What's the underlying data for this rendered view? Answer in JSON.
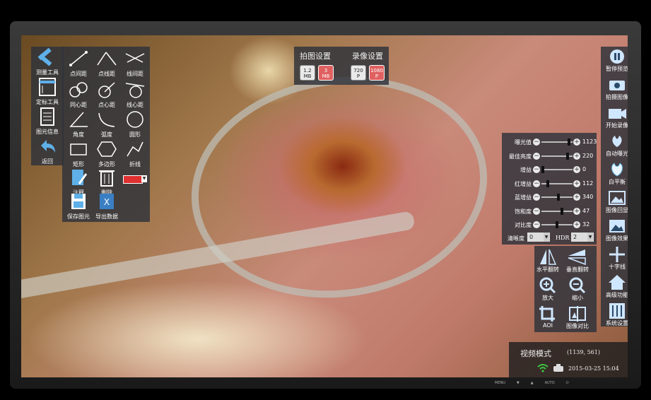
{
  "left_panel": {
    "main_tools": [
      {
        "label": "测量工具"
      },
      {
        "label": "定标工具"
      },
      {
        "label": "图元信息"
      },
      {
        "label": "返回"
      }
    ],
    "measure_tools": [
      {
        "label": "点间距"
      },
      {
        "label": "点线距"
      },
      {
        "label": "线间距"
      },
      {
        "label": "同心距"
      },
      {
        "label": "点心距"
      },
      {
        "label": "线心距"
      },
      {
        "label": "角度"
      },
      {
        "label": "弧度"
      },
      {
        "label": "圆形"
      },
      {
        "label": "矩形"
      },
      {
        "label": "多边形"
      },
      {
        "label": "折线"
      },
      {
        "label": "注释"
      },
      {
        "label": "删除"
      }
    ],
    "bottom_tools": [
      {
        "label": "保存图元"
      },
      {
        "label": "导出数据"
      }
    ],
    "color_swatch": "#e03030"
  },
  "top_panel": {
    "capture_title": "拍图设置",
    "record_title": "录像设置",
    "capture_options": [
      {
        "line1": "1.2",
        "line2": "MB"
      },
      {
        "line1": "3",
        "line2": "MB"
      }
    ],
    "record_options": [
      {
        "line1": "720",
        "line2": "P"
      },
      {
        "line1": "1080",
        "line2": "P"
      }
    ]
  },
  "right_tools": [
    {
      "label": "暂停预览"
    },
    {
      "label": "拍摄图像"
    },
    {
      "label": "开始录像"
    },
    {
      "label": "自动曝光"
    },
    {
      "label": "白平衡"
    },
    {
      "label": "图像回显"
    },
    {
      "label": "图像效果"
    },
    {
      "label": "十字线"
    },
    {
      "label": "高级功能"
    },
    {
      "label": "系统设置"
    }
  ],
  "sliders": [
    {
      "label": "曝光值",
      "value": "1123",
      "pos": 0.92
    },
    {
      "label": "最佳亮度",
      "value": "220",
      "pos": 0.88
    },
    {
      "label": "增益",
      "value": "0",
      "pos": 0.0
    },
    {
      "label": "红增益",
      "value": "112",
      "pos": 0.18
    },
    {
      "label": "蓝增益",
      "value": "340",
      "pos": 0.55
    },
    {
      "label": "饱和度",
      "value": "47",
      "pos": 0.68
    },
    {
      "label": "对比度",
      "value": "32",
      "pos": 0.5
    }
  ],
  "sharpness": {
    "label": "清晰度",
    "value": "0"
  },
  "hdr": {
    "label": "HDR",
    "value": "2"
  },
  "transform_tools": [
    {
      "label": "水平翻转"
    },
    {
      "label": "垂直翻转"
    },
    {
      "label": "放大"
    },
    {
      "label": "缩小"
    },
    {
      "label": "AOI"
    },
    {
      "label": "图像对比"
    }
  ],
  "status": {
    "mode": "视频模式",
    "coords": "(1139, 561)",
    "datetime": "2015-03-25  15:04"
  },
  "bezel": [
    "MENU",
    "▼",
    "▲",
    "AUTO",
    "⏻"
  ]
}
